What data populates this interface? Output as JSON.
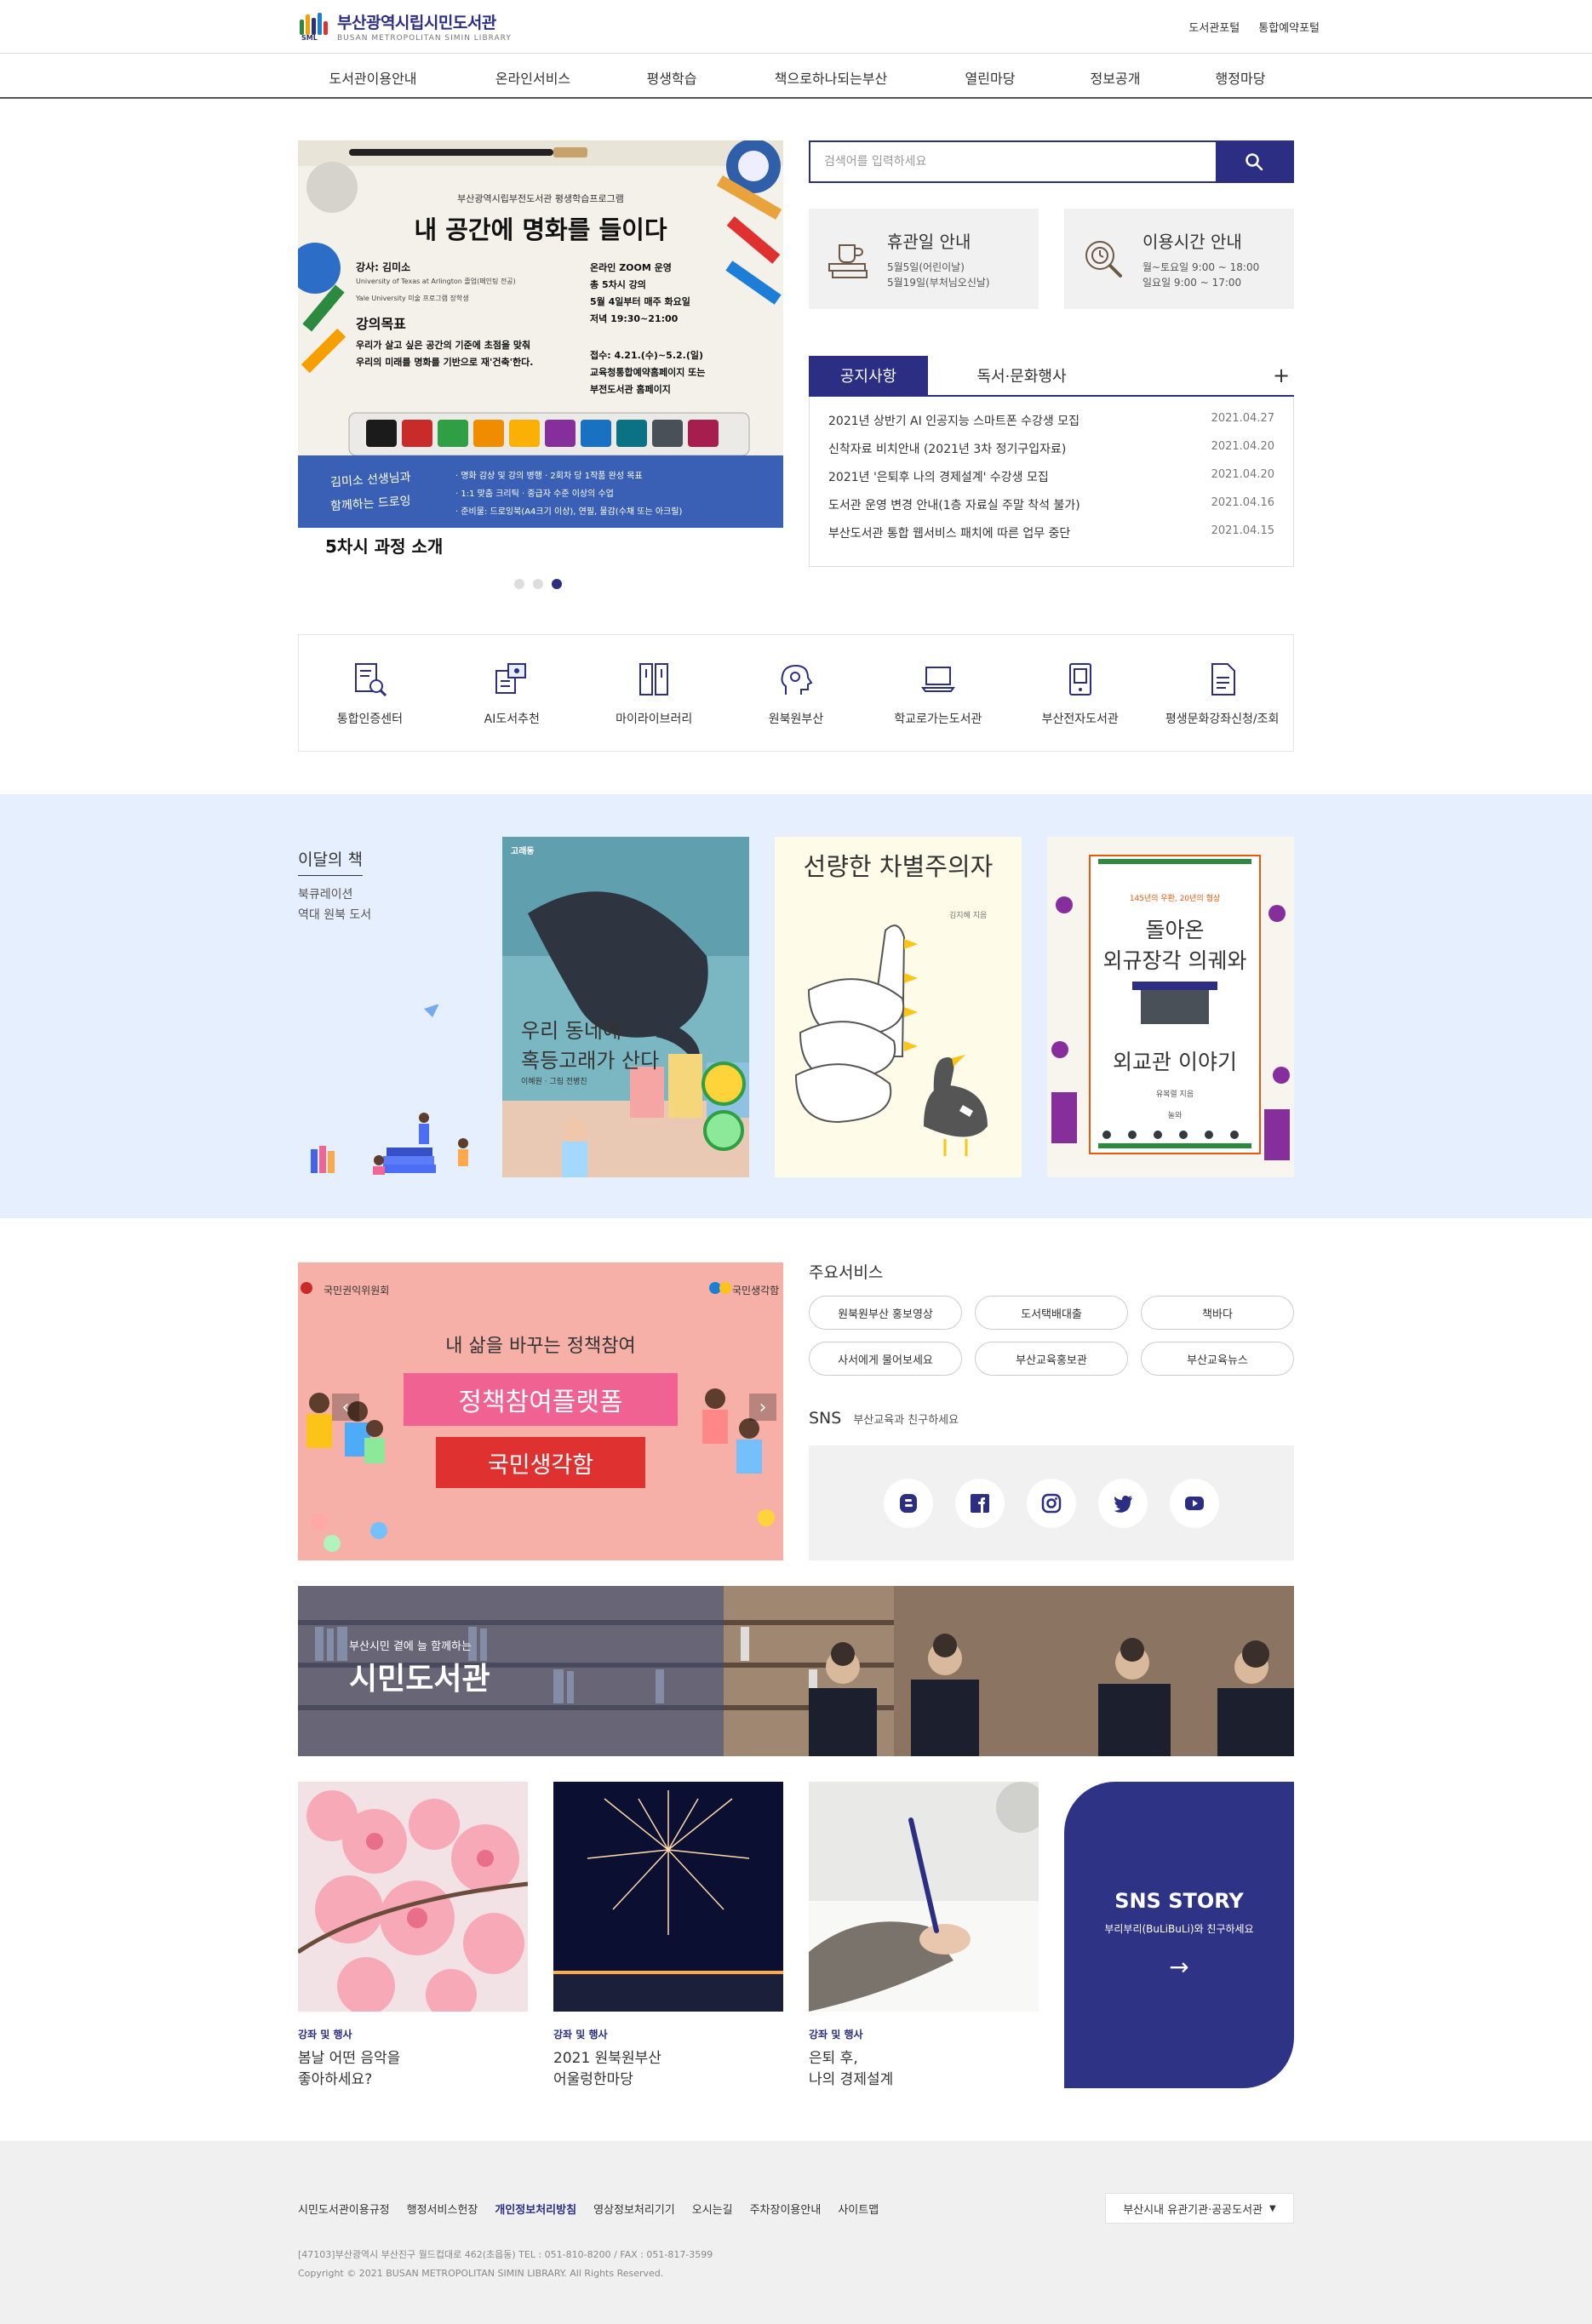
{
  "header": {
    "logo_title": "부산광역시립시민도서관",
    "logo_subtitle": "BUSAN METROPOLITAN SIMIN LIBRARY",
    "logo_mark": "SML",
    "util_links": [
      "도서관포털",
      "통합예약포털"
    ]
  },
  "nav": [
    "도서관이용안내",
    "온라인서비스",
    "평생학습",
    "책으로하나되는부산",
    "열린마당",
    "정보공개",
    "행정마당"
  ],
  "slide": {
    "org": "부산광역시립부전도서관 평생학습프로그램",
    "title": "내 공간에 명화를 들이다",
    "lecturer": "강사: 김미소",
    "lecturer_bio1": "University of Texas at Arlington 졸업(페인팅 전공)",
    "lecturer_bio2": "Yale University 미술 프로그램 장학생",
    "schedule": [
      "온라인 ZOOM 운영",
      "총 5차시 강의",
      "5월 4일부터 매주 화요일",
      "저녁 19:30~21:00"
    ],
    "goal_title": "강의목표",
    "goal_text1": "우리가 살고 싶은 공간의 기준에 초점을 맞춰",
    "goal_text2": "우리의 미래를 명화를 기반으로 재'건축'한다.",
    "apply1": "접수: 4.21.(수)~5.2.(일)",
    "apply2": "교육청통합예약홈페이지 또는",
    "apply3": "부전도서관 홈페이지",
    "script1": "김미소 선생님과",
    "script2": "함께하는 드로잉",
    "bullets": [
      "· 명화 감상 및 강의 병행  ·  2회차 당 1작품 완성 목표",
      "· 1:1 맞춤 크리틱  ·  중급자 수준 이상의 수업",
      "· 준비물: 드로잉북(A4크기 이상), 연필, 물감(수채 또는 아크릴)"
    ],
    "caption": "5차시 과정 소개",
    "dot_count": 3,
    "active_dot": 3
  },
  "search": {
    "placeholder": "검색어를 입력하세요",
    "icon": "search-icon"
  },
  "closed_info": {
    "title": "휴관일 안내",
    "line1": "5월5일(어린이날)",
    "line2": "5월19일(부처님오신날)",
    "icon": "book-cup-icon"
  },
  "hours_info": {
    "title": "이용시간 안내",
    "line1": "월~토요일 9:00 ~ 18:00",
    "line2": "일요일 9:00 ~ 17:00",
    "icon": "clock-search-icon"
  },
  "notice": {
    "tab_active": "공지사항",
    "tab_other": "독서·문화행사",
    "more": "+",
    "items": [
      {
        "title": "2021년 상반기 AI 인공지능 스마트폰 수강생 모집",
        "date": "2021.04.27"
      },
      {
        "title": "신착자료 비치안내 (2021년 3차 정기구입자료)",
        "date": "2021.04.20"
      },
      {
        "title": "2021년 '은퇴후 나의 경제설계' 수강생 모집",
        "date": "2021.04.20"
      },
      {
        "title": "도서관 운영 변경 안내(1층 자료실 주말 착석 불가)",
        "date": "2021.04.16"
      },
      {
        "title": "부산도서관 통합 웹서비스 패치에 따른 업무 중단",
        "date": "2021.04.15"
      }
    ]
  },
  "quick_links": [
    "통합인증센터",
    "AI도서추천",
    "마이라이브러리",
    "원북원부산",
    "학교로가는도서관",
    "부산전자도서관",
    "평생문화강좌신청/조회"
  ],
  "book_menu": {
    "title": "이달의 책",
    "items": [
      "북큐레이션",
      "역대 원북 도서"
    ]
  },
  "books": [
    {
      "title1": "우리 동네에",
      "title2": "혹등고래가 산다",
      "tag": "고래동",
      "author": "이혜원 · 그림 전병진"
    },
    {
      "title1": "선량한 차별주의자",
      "author": "김지혜 지음"
    },
    {
      "top": "145년의 우환, 20년의 협상",
      "title1": "돌아온",
      "title2": "외규장각 의궤와",
      "title3": "외교관 이야기",
      "author": "유복렬 지음",
      "publisher": "눌와"
    }
  ],
  "policy_banner": {
    "org1": "국민권익위원회",
    "org2": "국민생각함",
    "line1": "내 삶을 바꾸는 정책참여",
    "line2": "정책참여플랫폼",
    "line3": "국민생각함"
  },
  "services": {
    "title": "주요서비스",
    "items": [
      "원북원부산 홍보영상",
      "도서택배대출",
      "책바다",
      "사서에게 물어보세요",
      "부산교육홍보관",
      "부산교육뉴스"
    ]
  },
  "sns": {
    "title": "SNS",
    "subtitle": "부산교육과 친구하세요",
    "icons": [
      "blog-icon",
      "facebook-icon",
      "instagram-icon",
      "twitter-icon",
      "youtube-icon"
    ]
  },
  "main_banner": {
    "small": "부산시민 곁에 늘 함께하는",
    "big": "시민도서관"
  },
  "cards": [
    {
      "category": "강좌 및 행사",
      "title1": "봄날 어떤 음악을",
      "title2": "좋아하세요?"
    },
    {
      "category": "강좌 및 행사",
      "title1": "2021 원북원부산",
      "title2": "어울렁한마당"
    },
    {
      "category": "강좌 및 행사",
      "title1": "은퇴 후,",
      "title2": "나의 경제설계"
    }
  ],
  "story": {
    "title": "SNS STORY",
    "subtitle": "부리부리(BuLiBuLi)와 친구하세요",
    "arrow": "→"
  },
  "footer": {
    "links": [
      "시민도서관이용규정",
      "행정서비스헌장",
      "개인정보처리방침",
      "영상정보처리기기",
      "오시는길",
      "주차장이용안내",
      "사이트맵"
    ],
    "select": "부산시내 유관기관·공공도서관",
    "address": "[47103]부산광역시 부산진구 월드컵대로 462(초읍동) TEL : 051-810-8200 / FAX : 051-817-3599",
    "copyright": "Copyright © 2021 BUSAN METROPOLITAN SIMIN LIBRARY. All Rights Reserved."
  },
  "colors": {
    "primary": "#2b2e83",
    "book_band": "#e6effd",
    "policy_bg": "#f7b0a7",
    "footer_bg": "#f0f0f0"
  }
}
